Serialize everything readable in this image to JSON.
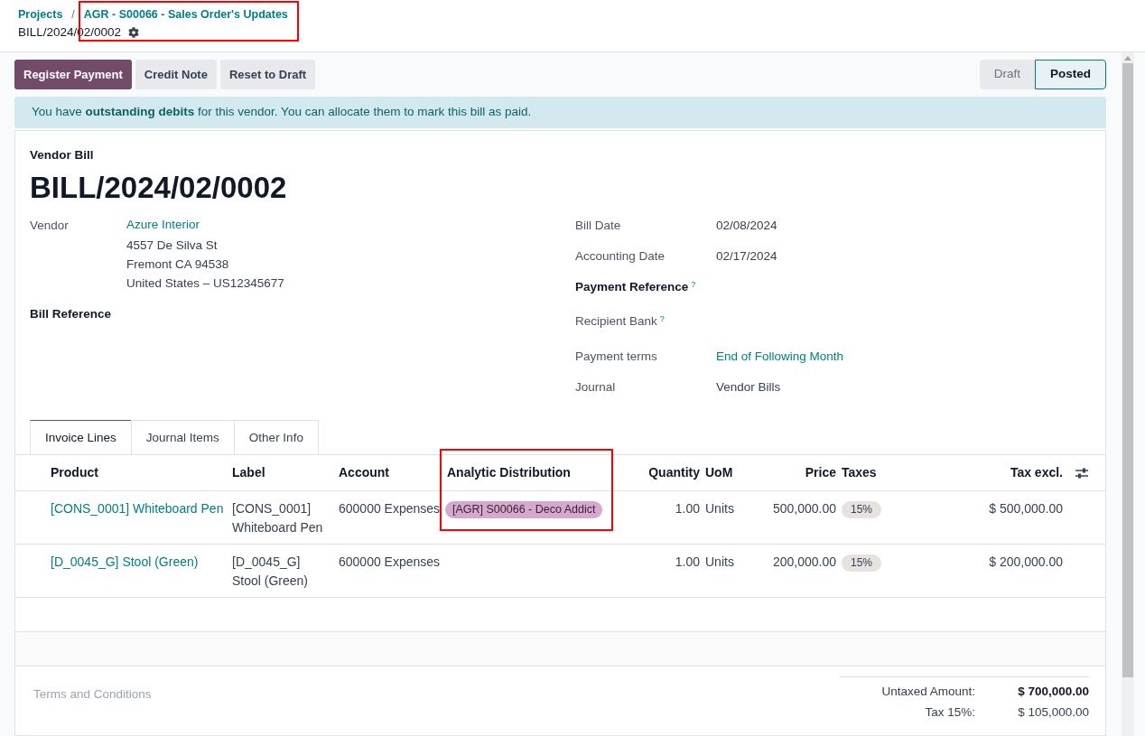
{
  "breadcrumb": {
    "items": [
      "Projects",
      "AGR - S00066 - Sales Order's Updates"
    ],
    "separator": "/",
    "current": "BILL/2024/02/0002"
  },
  "breadcrumb_highlighted": true,
  "actions": [
    {
      "label": "Register Payment",
      "kind": "primary"
    },
    {
      "label": "Credit Note",
      "kind": "secondary"
    },
    {
      "label": "Reset to Draft",
      "kind": "secondary"
    }
  ],
  "status_steps": [
    {
      "label": "Draft",
      "selected": false
    },
    {
      "label": "Posted",
      "selected": true
    }
  ],
  "alert": "You have **outstanding debits** for this vendor. You can allocate them to mark this bill as paid.",
  "form": {
    "type_label": "Vendor Bill",
    "title": "BILL/2024/02/0002",
    "vendor": {
      "label": "Vendor",
      "name": "Azure Interior",
      "address": [
        "4557 De Silva St",
        "Fremont CA 94538",
        "United States – US12345677"
      ]
    },
    "bill_reference": {
      "label": "Bill Reference"
    },
    "right_fields": [
      {
        "label": "Bill Date",
        "value": "02/08/2024",
        "kind": "text",
        "bold": false,
        "help": false
      },
      {
        "label": "Accounting Date",
        "value": "02/17/2024",
        "kind": "text",
        "bold": false,
        "help": false
      },
      {
        "label": "Payment Reference",
        "bold": true,
        "help": true
      },
      {
        "label": "Recipient Bank",
        "bold": false,
        "help": true
      },
      {
        "label": "Payment terms",
        "value": "End of Following Month",
        "kind": "link",
        "bold": false,
        "help": false
      },
      {
        "label": "Journal",
        "value": "Vendor Bills",
        "kind": "text",
        "bold": false,
        "help": false
      }
    ],
    "help_mark": "?"
  },
  "tabs": [
    {
      "label": "Invoice Lines",
      "selected": true
    },
    {
      "label": "Journal Items",
      "selected": false
    },
    {
      "label": "Other Info",
      "selected": false
    }
  ],
  "table": {
    "columns": [
      {
        "label": "Product",
        "highlighted": false
      },
      {
        "label": "Label",
        "highlighted": false
      },
      {
        "label": "Account",
        "highlighted": false
      },
      {
        "label": "Analytic Distribution",
        "highlighted": true
      },
      {
        "label": "Quantity",
        "highlighted": false
      },
      {
        "label": "UoM",
        "highlighted": false
      },
      {
        "label": "Price",
        "highlighted": false
      },
      {
        "label": "Taxes",
        "highlighted": false
      },
      {
        "label": "Tax excl.",
        "highlighted": false
      }
    ],
    "rows": [
      {
        "product": "[CONS_0001] Whiteboard Pen",
        "label": [
          "[CONS_0001]",
          "Whiteboard Pen"
        ],
        "account": "600000 Expenses",
        "analytic": "[AGR] S00066 - Deco Addict",
        "quantity": "1.00",
        "uom": "Units",
        "price": "500,000.00",
        "taxes": "15%",
        "tax_excl": "$ 500,000.00"
      },
      {
        "product": "[D_0045_G] Stool (Green)",
        "label": [
          "[D_0045_G]",
          "Stool (Green)"
        ],
        "account": "600000 Expenses",
        "quantity": "1.00",
        "uom": "Units",
        "price": "200,000.00",
        "taxes": "15%",
        "tax_excl": "$ 200,000.00"
      }
    ]
  },
  "terms_placeholder": "Terms and Conditions",
  "totals": [
    {
      "label": "Untaxed Amount:",
      "value": "$ 700,000.00",
      "bold": true
    },
    {
      "label": "Tax 15%:",
      "value": "$ 105,000.00",
      "bold": false
    }
  ]
}
